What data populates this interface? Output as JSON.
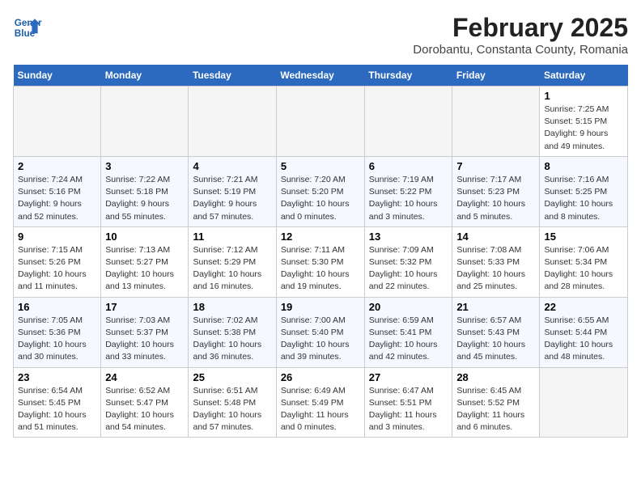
{
  "header": {
    "logo_line1": "General",
    "logo_line2": "Blue",
    "title": "February 2025",
    "subtitle": "Dorobantu, Constanta County, Romania"
  },
  "columns": [
    "Sunday",
    "Monday",
    "Tuesday",
    "Wednesday",
    "Thursday",
    "Friday",
    "Saturday"
  ],
  "weeks": [
    [
      {
        "day": "",
        "info": ""
      },
      {
        "day": "",
        "info": ""
      },
      {
        "day": "",
        "info": ""
      },
      {
        "day": "",
        "info": ""
      },
      {
        "day": "",
        "info": ""
      },
      {
        "day": "",
        "info": ""
      },
      {
        "day": "1",
        "info": "Sunrise: 7:25 AM\nSunset: 5:15 PM\nDaylight: 9 hours and 49 minutes."
      }
    ],
    [
      {
        "day": "2",
        "info": "Sunrise: 7:24 AM\nSunset: 5:16 PM\nDaylight: 9 hours and 52 minutes."
      },
      {
        "day": "3",
        "info": "Sunrise: 7:22 AM\nSunset: 5:18 PM\nDaylight: 9 hours and 55 minutes."
      },
      {
        "day": "4",
        "info": "Sunrise: 7:21 AM\nSunset: 5:19 PM\nDaylight: 9 hours and 57 minutes."
      },
      {
        "day": "5",
        "info": "Sunrise: 7:20 AM\nSunset: 5:20 PM\nDaylight: 10 hours and 0 minutes."
      },
      {
        "day": "6",
        "info": "Sunrise: 7:19 AM\nSunset: 5:22 PM\nDaylight: 10 hours and 3 minutes."
      },
      {
        "day": "7",
        "info": "Sunrise: 7:17 AM\nSunset: 5:23 PM\nDaylight: 10 hours and 5 minutes."
      },
      {
        "day": "8",
        "info": "Sunrise: 7:16 AM\nSunset: 5:25 PM\nDaylight: 10 hours and 8 minutes."
      }
    ],
    [
      {
        "day": "9",
        "info": "Sunrise: 7:15 AM\nSunset: 5:26 PM\nDaylight: 10 hours and 11 minutes."
      },
      {
        "day": "10",
        "info": "Sunrise: 7:13 AM\nSunset: 5:27 PM\nDaylight: 10 hours and 13 minutes."
      },
      {
        "day": "11",
        "info": "Sunrise: 7:12 AM\nSunset: 5:29 PM\nDaylight: 10 hours and 16 minutes."
      },
      {
        "day": "12",
        "info": "Sunrise: 7:11 AM\nSunset: 5:30 PM\nDaylight: 10 hours and 19 minutes."
      },
      {
        "day": "13",
        "info": "Sunrise: 7:09 AM\nSunset: 5:32 PM\nDaylight: 10 hours and 22 minutes."
      },
      {
        "day": "14",
        "info": "Sunrise: 7:08 AM\nSunset: 5:33 PM\nDaylight: 10 hours and 25 minutes."
      },
      {
        "day": "15",
        "info": "Sunrise: 7:06 AM\nSunset: 5:34 PM\nDaylight: 10 hours and 28 minutes."
      }
    ],
    [
      {
        "day": "16",
        "info": "Sunrise: 7:05 AM\nSunset: 5:36 PM\nDaylight: 10 hours and 30 minutes."
      },
      {
        "day": "17",
        "info": "Sunrise: 7:03 AM\nSunset: 5:37 PM\nDaylight: 10 hours and 33 minutes."
      },
      {
        "day": "18",
        "info": "Sunrise: 7:02 AM\nSunset: 5:38 PM\nDaylight: 10 hours and 36 minutes."
      },
      {
        "day": "19",
        "info": "Sunrise: 7:00 AM\nSunset: 5:40 PM\nDaylight: 10 hours and 39 minutes."
      },
      {
        "day": "20",
        "info": "Sunrise: 6:59 AM\nSunset: 5:41 PM\nDaylight: 10 hours and 42 minutes."
      },
      {
        "day": "21",
        "info": "Sunrise: 6:57 AM\nSunset: 5:43 PM\nDaylight: 10 hours and 45 minutes."
      },
      {
        "day": "22",
        "info": "Sunrise: 6:55 AM\nSunset: 5:44 PM\nDaylight: 10 hours and 48 minutes."
      }
    ],
    [
      {
        "day": "23",
        "info": "Sunrise: 6:54 AM\nSunset: 5:45 PM\nDaylight: 10 hours and 51 minutes."
      },
      {
        "day": "24",
        "info": "Sunrise: 6:52 AM\nSunset: 5:47 PM\nDaylight: 10 hours and 54 minutes."
      },
      {
        "day": "25",
        "info": "Sunrise: 6:51 AM\nSunset: 5:48 PM\nDaylight: 10 hours and 57 minutes."
      },
      {
        "day": "26",
        "info": "Sunrise: 6:49 AM\nSunset: 5:49 PM\nDaylight: 11 hours and 0 minutes."
      },
      {
        "day": "27",
        "info": "Sunrise: 6:47 AM\nSunset: 5:51 PM\nDaylight: 11 hours and 3 minutes."
      },
      {
        "day": "28",
        "info": "Sunrise: 6:45 AM\nSunset: 5:52 PM\nDaylight: 11 hours and 6 minutes."
      },
      {
        "day": "",
        "info": ""
      }
    ]
  ]
}
